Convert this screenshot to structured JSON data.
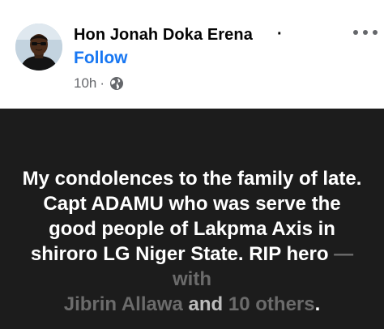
{
  "author": {
    "name": "Hon Jonah Doka Erena",
    "separator": "·",
    "follow_label": "Follow",
    "timestamp": "10h",
    "separator_meta": "·",
    "privacy_icon": "globe-icon"
  },
  "post": {
    "text": "My condolences to the family of late. Capt ADAMU who was serve the good people of Lakpma Axis in shiroro LG Niger State. RIP hero",
    "with_prefix": "— with",
    "tagged_person": "Jibrin Allawa",
    "and_label": "and",
    "others_label": "10 others",
    "period": ".",
    "background_color": "#1c1c1c"
  },
  "colors": {
    "accent": "#1877f2",
    "meta_text": "#65676b"
  }
}
